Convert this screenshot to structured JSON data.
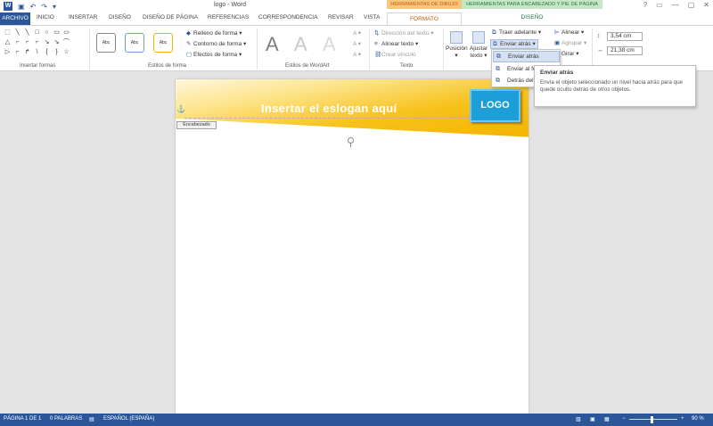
{
  "titlebar": {
    "doc_title": "logo - Word",
    "ctx_drawing": "HERRAMIENTAS DE DIBUJO",
    "ctx_header": "HERRAMIENTAS PARA ENCABEZADO Y PIE DE PÁGINA",
    "qat": [
      "save-icon",
      "undo-icon",
      "redo-icon"
    ],
    "window_controls": [
      "?",
      "▭",
      "—",
      "▢",
      "✕"
    ]
  },
  "tabs": {
    "archivo": "ARCHIVO",
    "inicio": "INICIO",
    "insertar": "INSERTAR",
    "diseno": "DISEÑO",
    "diseno_pagina": "DISEÑO DE PÁGINA",
    "referencias": "REFERENCIAS",
    "correspondencia": "CORRESPONDENCIA",
    "revisar": "REVISAR",
    "vista": "VISTA",
    "formato": "FORMATO",
    "diseno_ctx": "DISEÑO"
  },
  "ribbon": {
    "insertar_formas_label": "Insertar formas",
    "shape_glyphs": [
      "⬚",
      "╲",
      "╲",
      "□",
      "○",
      "▭",
      "▭",
      "△",
      "⌐",
      "⌐",
      "⌐",
      "↘",
      "↘",
      "⌒",
      "▷",
      "⌐",
      "↱",
      "\\",
      "{",
      "}",
      "☆"
    ],
    "estilo_abc": [
      "Abc",
      "Abc",
      "Abc"
    ],
    "relleno": "Relleno de forma",
    "contorno": "Contorno de forma",
    "efectos": "Efectos de forma",
    "estilos_forma_label": "Estilos de forma",
    "wordart_letters": [
      "A",
      "A",
      "A"
    ],
    "estilos_wordart_label": "Estilos de WordArt",
    "direccion_texto": "Dirección del texto",
    "alinear_texto": "Alinear texto",
    "crear_vinculo": "Crear vínculo",
    "texto_label": "Texto",
    "posicion": "Posición",
    "ajustar_texto": "Ajustar texto",
    "traer_adelante": "Traer adelante",
    "enviar_atras": "Enviar atrás",
    "alinear": "Alinear",
    "agrupar": "Agrupar",
    "girar": "Girar",
    "height_value": "3,54 cm",
    "width_value": "21,38 cm"
  },
  "dropdown": {
    "items": [
      "Enviar atrás",
      "Enviar al fondo",
      "Detrás del texto"
    ]
  },
  "tooltip": {
    "title": "Enviar atrás",
    "body": "Envía el objeto seleccionado un nivel hacia atrás para que quede oculto detrás de otros objetos."
  },
  "document": {
    "slogan": "Insertar el eslogan aquí",
    "logo": "LOGO",
    "header_tag": "Encabezado"
  },
  "statusbar": {
    "page": "PÁGINA 1 DE 1",
    "words": "0 PALABRAS",
    "language": "ESPAÑOL (ESPAÑA)",
    "zoom": "90 %"
  },
  "colors": {
    "word_blue": "#2b579a",
    "ctx_drawing_orange": "#c55a11",
    "ctx_header_green": "#217346",
    "header_yellow": "#f4b300",
    "logo_blue": "#1c9fd8"
  }
}
